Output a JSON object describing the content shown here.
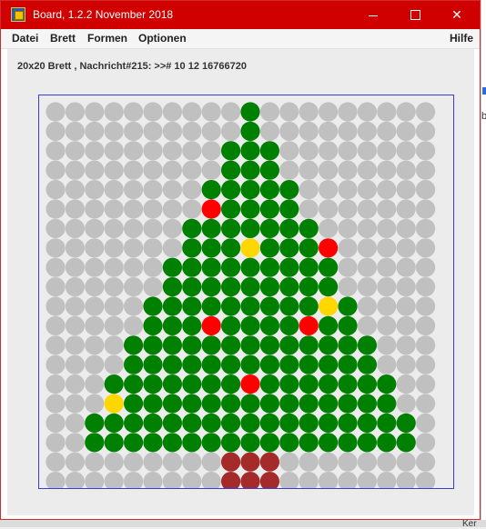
{
  "window": {
    "title": "Board, 1.2.2 November 2018",
    "minimize_glyph": "",
    "close_glyph": "✕"
  },
  "menu": {
    "items": [
      "Datei",
      "Brett",
      "Formen",
      "Optionen"
    ],
    "help": "Hilfe"
  },
  "status": {
    "text": "20x20 Brett , Nachricht#215: >># 10 12 16766720"
  },
  "background": {
    "right_edge_text": "b",
    "bottom_text": "Ker"
  },
  "board": {
    "size": 20,
    "legend": {
      ".": "#c0c0c0",
      "G": "#008000",
      "R": "#ff0000",
      "Y": "#ffd700",
      "B": "#a52a2a"
    },
    "rows": [
      "..........G.........",
      "..........G.........",
      ".........GGG........",
      ".........GGG........",
      "........GGGGG.......",
      "........RGGGG.......",
      ".......GGGGGGG......",
      ".......GGGYGGGR.....",
      "......GGGGGGGGG.....",
      "......GGGGGGGGG.....",
      ".....GGGGGGGGGYG....",
      ".....GGGRGGGGRGG....",
      "....GGGGGGGGGGGGG...",
      "....GGGGGGGGGGGGG...",
      "...GGGGGGGRGGGGGGG..",
      "...YGGGGGGGGGGGGGG..",
      "..GGGGGGGGGGGGGGGGG.",
      "..GGGGGGGGGGGGGGGGG.",
      ".........BBB........",
      ".........BBB........"
    ]
  }
}
